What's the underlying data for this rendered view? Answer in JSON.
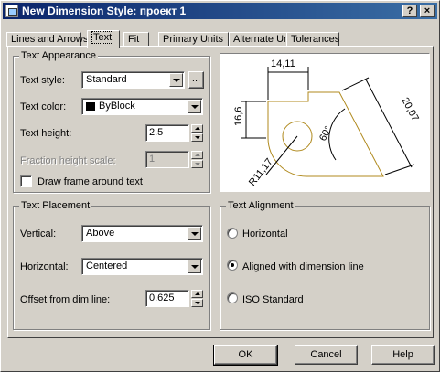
{
  "window": {
    "title": "New Dimension Style: проект 1",
    "help_button": "?",
    "close_button": "×"
  },
  "tabs": [
    {
      "label": "Lines and Arrows"
    },
    {
      "label": "Text"
    },
    {
      "label": "Fit"
    },
    {
      "label": "Primary Units"
    },
    {
      "label": "Alternate Units"
    },
    {
      "label": "Tolerances"
    }
  ],
  "text_appearance": {
    "title": "Text Appearance",
    "style_label": "Text style:",
    "style_value": "Standard",
    "style_browse": "...",
    "color_label": "Text color:",
    "color_value": "ByBlock",
    "color_swatch": "#000000",
    "height_label": "Text height:",
    "height_value": "2.5",
    "fraction_label": "Fraction height scale:",
    "fraction_value": "1",
    "frame_label": "Draw frame around text"
  },
  "text_placement": {
    "title": "Text Placement",
    "vertical_label": "Vertical:",
    "vertical_value": "Above",
    "horizontal_label": "Horizontal:",
    "horizontal_value": "Centered",
    "offset_label": "Offset from dim line:",
    "offset_value": "0.625"
  },
  "text_alignment": {
    "title": "Text Alignment",
    "options": [
      {
        "label": "Horizontal",
        "selected": false
      },
      {
        "label": "Aligned with dimension line",
        "selected": true
      },
      {
        "label": "ISO Standard",
        "selected": false
      }
    ]
  },
  "preview": {
    "dim_top": "14,11",
    "dim_left": "16,6",
    "dim_right": "20,07",
    "dim_angle": "60°",
    "dim_radius": "R11,17",
    "line_color": "#b08a1e"
  },
  "buttons": {
    "ok": "OK",
    "cancel": "Cancel",
    "help": "Help"
  }
}
